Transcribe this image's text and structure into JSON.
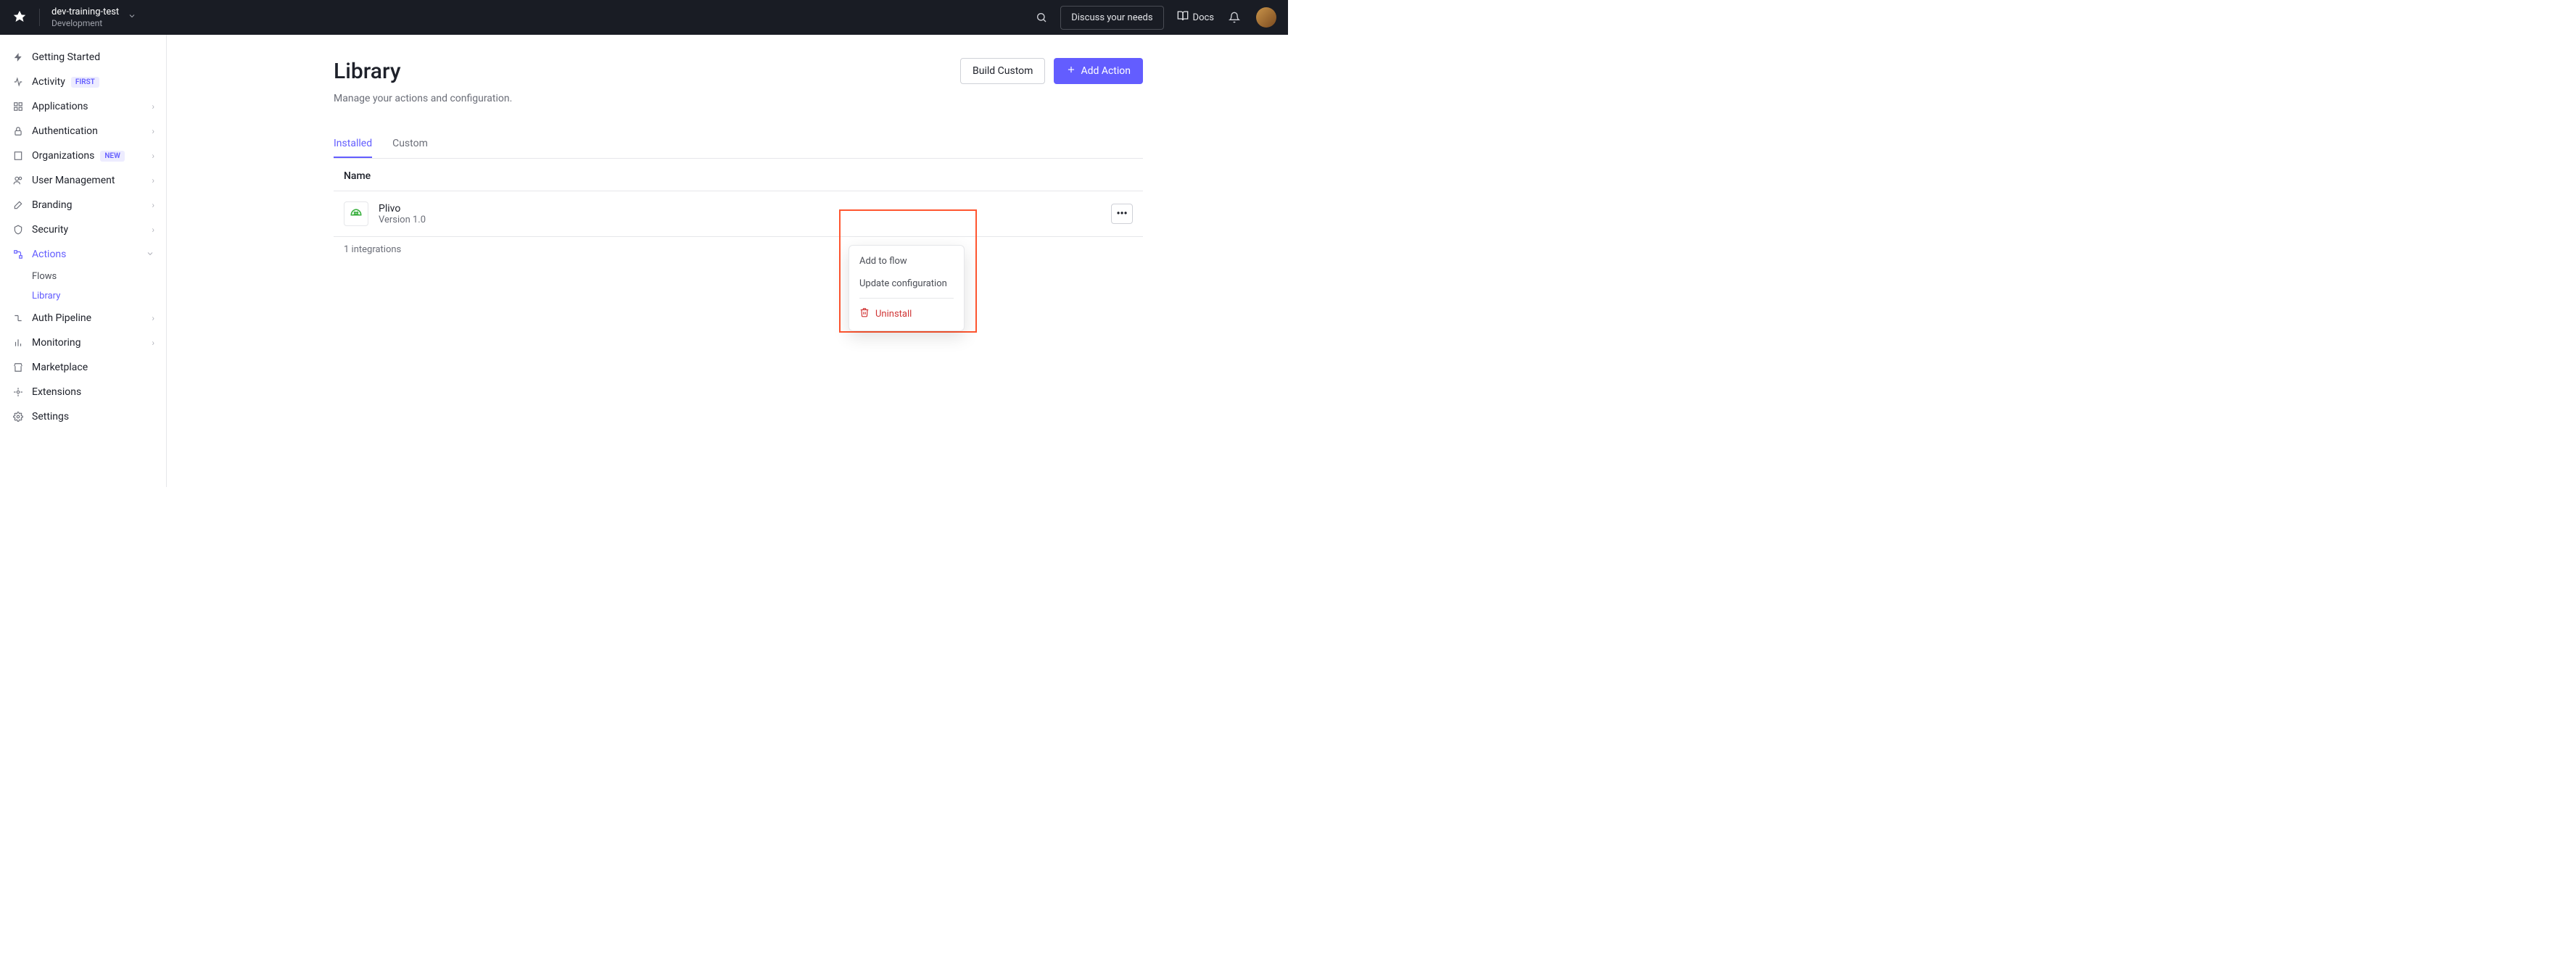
{
  "header": {
    "tenant_name": "dev-training-test",
    "tenant_env": "Development",
    "discuss_label": "Discuss your needs",
    "docs_label": "Docs"
  },
  "sidebar": {
    "items": [
      {
        "label": "Getting Started"
      },
      {
        "label": "Activity",
        "badge": "FIRST"
      },
      {
        "label": "Applications",
        "expandable": true
      },
      {
        "label": "Authentication",
        "expandable": true
      },
      {
        "label": "Organizations",
        "badge": "NEW",
        "expandable": true
      },
      {
        "label": "User Management",
        "expandable": true
      },
      {
        "label": "Branding",
        "expandable": true
      },
      {
        "label": "Security",
        "expandable": true
      },
      {
        "label": "Actions",
        "expandable": true,
        "active": true
      },
      {
        "label": "Auth Pipeline",
        "expandable": true
      },
      {
        "label": "Monitoring",
        "expandable": true
      },
      {
        "label": "Marketplace"
      },
      {
        "label": "Extensions"
      },
      {
        "label": "Settings"
      }
    ],
    "actions_sub": [
      {
        "label": "Flows"
      },
      {
        "label": "Library",
        "active": true
      }
    ]
  },
  "page": {
    "title": "Library",
    "description": "Manage your actions and configuration.",
    "build_custom_label": "Build Custom",
    "add_action_label": "Add Action"
  },
  "tabs": {
    "installed": "Installed",
    "custom": "Custom"
  },
  "table": {
    "header_name": "Name",
    "rows": [
      {
        "name": "Plivo",
        "version": "Version 1.0"
      }
    ],
    "footer": "1 integrations"
  },
  "popover": {
    "add_to_flow": "Add to flow",
    "update_config": "Update configuration",
    "uninstall": "Uninstall"
  }
}
